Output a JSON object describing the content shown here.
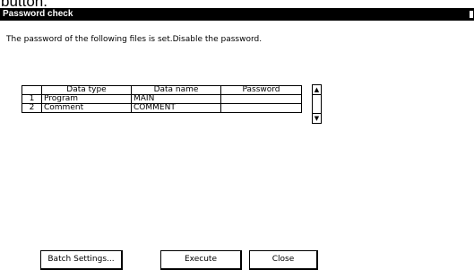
{
  "cropped_text": "button.",
  "dialog": {
    "title": "Password check",
    "message": "The password of the following files is set.Disable the password."
  },
  "table": {
    "headers": [
      "",
      "Data type",
      "Data name",
      "Password"
    ],
    "rows": [
      {
        "no": "1",
        "data_type": "Program",
        "data_name": "MAIN",
        "password": ""
      },
      {
        "no": "2",
        "data_type": "Comment",
        "data_name": "COMMENT",
        "password": ""
      }
    ],
    "scroll_up_icon": "triangle-up",
    "scroll_down_icon": "triangle-down"
  },
  "buttons": {
    "batch": "Batch Settings...",
    "execute": "Execute",
    "close": "Close"
  }
}
